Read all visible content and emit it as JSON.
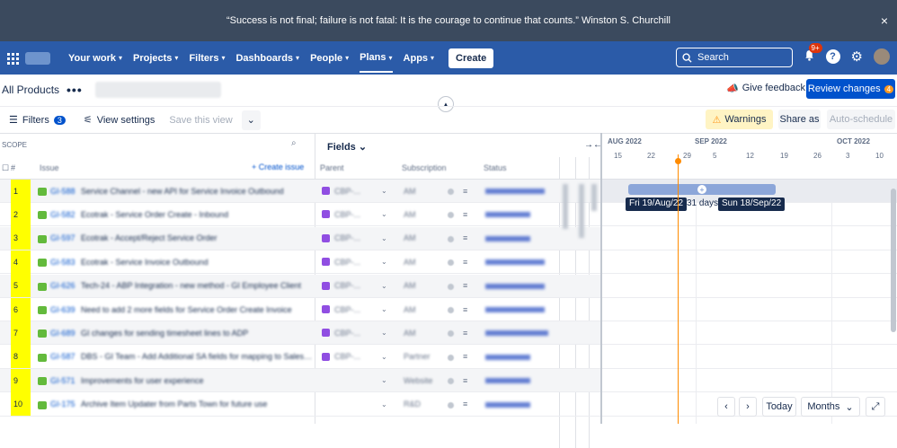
{
  "banner": {
    "quote": "“Success is not final; failure is not fatal: It is the courage to continue that counts.” Winston S. Churchill",
    "close": "×"
  },
  "nav": {
    "items": [
      {
        "label": "Your work"
      },
      {
        "label": "Projects"
      },
      {
        "label": "Filters"
      },
      {
        "label": "Dashboards"
      },
      {
        "label": "People"
      },
      {
        "label": "Plans"
      },
      {
        "label": "Apps"
      }
    ],
    "create": "Create",
    "search_placeholder": "Search",
    "notifications": "9+",
    "help": "?",
    "settings": "⚙"
  },
  "plan": {
    "title": "All Products",
    "more": "•••",
    "give_feedback": "Give feedback",
    "review_changes": "Review changes",
    "review_count": "4"
  },
  "toolbar": {
    "filters": "Filters",
    "filters_count": "3",
    "view_settings": "View settings",
    "save_view": "Save this view",
    "warnings": "Warnings",
    "share": "Share as",
    "auto_schedule": "Auto-schedule"
  },
  "header": {
    "scope": "SCOPE",
    "fields": "Fields",
    "col_num": "#",
    "col_issue": "Issue",
    "create_issue": "Create issue",
    "col_parent": "Parent",
    "col_subscription": "Subscription",
    "col_status": "Status"
  },
  "timeline": {
    "months": [
      "AUG 2022",
      "SEP 2022",
      "OCT 2022"
    ],
    "days": [
      "15",
      "22",
      "29",
      "5",
      "12",
      "19",
      "26",
      "3",
      "10"
    ],
    "start_date": "Fri 19/Aug/22",
    "duration": "31 days",
    "end_date": "Sun 18/Sep/22",
    "today_btn": "Today",
    "months_btn": "Months"
  },
  "rows": [
    {
      "num": "1",
      "key": "GI-588",
      "summary": "Service Channel - new API for Service Invoice Outbound",
      "parent": "CBP-...",
      "sub": "AM",
      "status_w": 66
    },
    {
      "num": "2",
      "key": "GI-582",
      "summary": "Ecotrak - Service Order Create - Inbound",
      "parent": "CBP-...",
      "sub": "AM",
      "status_w": 50
    },
    {
      "num": "3",
      "key": "GI-597",
      "summary": "Ecotrak - Accept/Reject Service Order",
      "parent": "CBP-...",
      "sub": "AM",
      "status_w": 50
    },
    {
      "num": "4",
      "key": "GI-583",
      "summary": "Ecotrak - Service Invoice Outbound",
      "parent": "CBP-...",
      "sub": "AM",
      "status_w": 66
    },
    {
      "num": "5",
      "key": "GI-626",
      "summary": "Tech-24 - ABP Integration - new method - GI Employee Client",
      "parent": "CBP-...",
      "sub": "AM",
      "status_w": 66
    },
    {
      "num": "6",
      "key": "GI-639",
      "summary": "Need to add 2 more fields for Service Order Create Invoice",
      "parent": "CBP-...",
      "sub": "AM",
      "status_w": 66
    },
    {
      "num": "7",
      "key": "GI-689",
      "summary": "GI changes for sending timesheet lines to ADP",
      "parent": "CBP-...",
      "sub": "AM",
      "status_w": 70
    },
    {
      "num": "8",
      "key": "GI-587",
      "summary": "DBS - GI Team - Add Additional SA fields for mapping to Salesforce",
      "parent": "CBP-...",
      "sub": "Partner",
      "status_w": 50
    },
    {
      "num": "9",
      "key": "GI-571",
      "summary": "Improvements for user experience",
      "parent": "",
      "sub": "Website",
      "status_w": 50
    },
    {
      "num": "10",
      "key": "GI-175",
      "summary": "Archive Item Updater from Parts Town for future use",
      "parent": "",
      "sub": "R&D",
      "status_w": 50
    }
  ]
}
